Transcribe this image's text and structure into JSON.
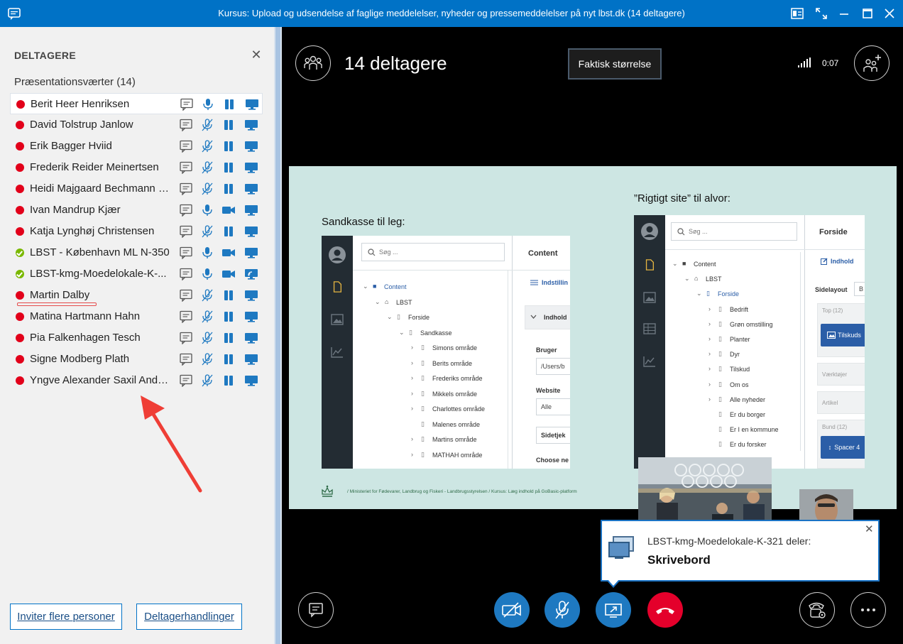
{
  "window": {
    "title": "Kursus: Upload og udsendelse af faglige meddelelser, nyheder og pressemeddelelser på nyt lbst.dk (14 deltagere)"
  },
  "panel": {
    "header": "DELTAGERE",
    "group_label": "Præsentationsværter (14)",
    "participants": [
      {
        "name": "Berit Heer Henriksen",
        "status": "red",
        "mic": "on",
        "video": "paused",
        "screen": "on"
      },
      {
        "name": "David Tolstrup Janlow",
        "status": "red",
        "mic": "muted",
        "video": "paused",
        "screen": "on"
      },
      {
        "name": "Erik Bagger Hviid",
        "status": "red",
        "mic": "muted",
        "video": "paused",
        "screen": "on"
      },
      {
        "name": "Frederik Reider Meinertsen",
        "status": "red",
        "mic": "muted",
        "video": "paused",
        "screen": "on"
      },
      {
        "name": "Heidi Majgaard Bechmann P...",
        "status": "red",
        "mic": "muted",
        "video": "paused",
        "screen": "on"
      },
      {
        "name": "Ivan Mandrup Kjær",
        "status": "red",
        "mic": "on",
        "video": "camera",
        "screen": "on"
      },
      {
        "name": "Katja Lynghøj Christensen",
        "status": "red",
        "mic": "muted",
        "video": "paused",
        "screen": "on"
      },
      {
        "name": "LBST - København ML N-350",
        "status": "green",
        "mic": "on",
        "video": "camera",
        "screen": "on"
      },
      {
        "name": "LBST-kmg-Moedelokale-K-...",
        "status": "green",
        "mic": "on",
        "video": "camera",
        "screen": "sharing"
      },
      {
        "name": "Martin Dalby",
        "status": "red",
        "mic": "muted",
        "video": "paused",
        "screen": "on"
      },
      {
        "name": "Matina Hartmann Hahn",
        "status": "red",
        "mic": "muted",
        "video": "paused",
        "screen": "on"
      },
      {
        "name": "Pia Falkenhagen Tesch",
        "status": "red",
        "mic": "muted",
        "video": "paused",
        "screen": "on"
      },
      {
        "name": "Signe Modberg Plath",
        "status": "red",
        "mic": "muted",
        "video": "paused",
        "screen": "on"
      },
      {
        "name": "Yngve Alexander Saxil Ande...",
        "status": "red",
        "mic": "muted",
        "video": "paused",
        "screen": "on"
      }
    ],
    "invite_button": "Inviter flere personer",
    "actions_button": "Deltagerhandlinger"
  },
  "stage": {
    "participant_count": "14 deltagere",
    "actual_size_button": "Faktisk størrelse",
    "call_time": "0:07"
  },
  "slide": {
    "left_caption": "Sandkasse til leg:",
    "right_caption": "”Rigtigt site” til alvor:",
    "footer": "/ Ministeriet for Fødevarer, Landbrug og Fiskeri - Landbrugsstyrelsen / Kursus: Læg indhold på GoBasic-platform",
    "left_shot": {
      "search_placeholder": "Søg ...",
      "content_header": "Content",
      "settings_link": "Indstillin",
      "content_section": "Indhold",
      "tree": [
        {
          "label": "Content",
          "indent": 0,
          "arrow": "open",
          "icon": "folder",
          "blue": true
        },
        {
          "label": "LBST",
          "indent": 1,
          "arrow": "open",
          "icon": "home",
          "blue": false
        },
        {
          "label": "Forside",
          "indent": 2,
          "arrow": "open",
          "icon": "page",
          "blue": false
        },
        {
          "label": "Sandkasse",
          "indent": 3,
          "arrow": "open",
          "icon": "page",
          "blue": false
        },
        {
          "label": "Simons område",
          "indent": 4,
          "arrow": "closed",
          "icon": "page",
          "blue": false
        },
        {
          "label": "Berits område",
          "indent": 4,
          "arrow": "closed",
          "icon": "page",
          "blue": false
        },
        {
          "label": "Frederiks område",
          "indent": 4,
          "arrow": "closed",
          "icon": "page",
          "blue": false
        },
        {
          "label": "Mikkels område",
          "indent": 4,
          "arrow": "closed",
          "icon": "page",
          "blue": false
        },
        {
          "label": "Charlottes område",
          "indent": 4,
          "arrow": "closed",
          "icon": "page",
          "blue": false
        },
        {
          "label": "Malenes område",
          "indent": 4,
          "arrow": "none",
          "icon": "page",
          "blue": false
        },
        {
          "label": "Martins område",
          "indent": 4,
          "arrow": "closed",
          "icon": "page",
          "blue": false
        },
        {
          "label": "MATHAH område",
          "indent": 4,
          "arrow": "closed",
          "icon": "page",
          "blue": false
        }
      ],
      "user_label": "Bruger",
      "user_value": "/Users/b",
      "website_label": "Website",
      "website_value": "Alle",
      "pages_button": "Sidetjek",
      "choose_label": "Choose ne"
    },
    "right_shot": {
      "search_placeholder": "Søg ...",
      "header": "Forside",
      "content_tab": "Indhold",
      "layout_label": "Sidelayout",
      "layout_value": "B",
      "tree": [
        {
          "label": "Content",
          "indent": 0,
          "arrow": "open",
          "icon": "folder",
          "blue": false
        },
        {
          "label": "LBST",
          "indent": 1,
          "arrow": "open",
          "icon": "home",
          "blue": false
        },
        {
          "label": "Forside",
          "indent": 2,
          "arrow": "open",
          "icon": "page",
          "blue": true
        },
        {
          "label": "Bedrift",
          "indent": 3,
          "arrow": "closed",
          "icon": "page",
          "blue": false
        },
        {
          "label": "Grøn omstilling",
          "indent": 3,
          "arrow": "closed",
          "icon": "page",
          "blue": false
        },
        {
          "label": "Planter",
          "indent": 3,
          "arrow": "closed",
          "icon": "page",
          "blue": false
        },
        {
          "label": "Dyr",
          "indent": 3,
          "arrow": "closed",
          "icon": "page",
          "blue": false
        },
        {
          "label": "Tilskud",
          "indent": 3,
          "arrow": "closed",
          "icon": "page",
          "blue": false
        },
        {
          "label": "Om os",
          "indent": 3,
          "arrow": "closed",
          "icon": "page",
          "blue": false
        },
        {
          "label": "Alle nyheder",
          "indent": 3,
          "arrow": "closed",
          "icon": "page",
          "blue": false
        },
        {
          "label": "Er du borger",
          "indent": 3,
          "arrow": "none",
          "icon": "page",
          "blue": false
        },
        {
          "label": "Er I en kommune",
          "indent": 3,
          "arrow": "none",
          "icon": "page",
          "blue": false
        },
        {
          "label": "Er du forsker",
          "indent": 3,
          "arrow": "none",
          "icon": "page",
          "blue": false
        }
      ],
      "box_top": "Top (12)",
      "box_top_button": "Tilskuds",
      "box_tools": "Værktøjer",
      "box_article": "Artikel",
      "box_bottom": "Bund (12)",
      "box_bottom_button": "Spacer 4"
    }
  },
  "toast": {
    "line1": "LBST-kmg-Moedelokale-K-321 deler:",
    "line2": "Skrivebord"
  },
  "colors": {
    "titlebar": "#0072c6",
    "control_blue": "#1e79c1",
    "hangup_red": "#e4002b",
    "status_red": "#e2001a",
    "status_green": "#7ab800"
  }
}
